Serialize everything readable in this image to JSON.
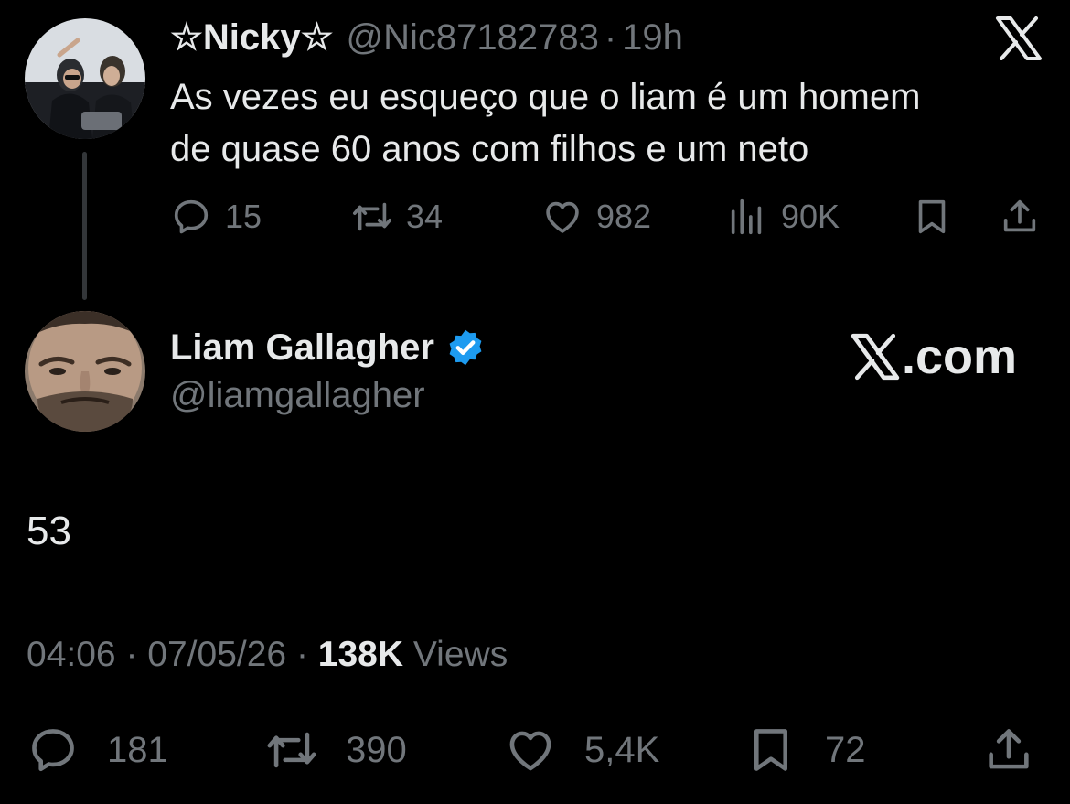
{
  "parent_tweet": {
    "display_name": "☆Nicky☆",
    "handle": "@Nic87182783",
    "separator": "·",
    "time": "19h",
    "text_line_1": "As vezes eu esqueço que o liam é um homem",
    "text_line_2": "de quase 60 anos com filhos e um neto",
    "actions": {
      "replies": "15",
      "reposts": "34",
      "likes": "982",
      "views": "90K"
    }
  },
  "main_tweet": {
    "display_name": "Liam Gallagher",
    "handle": "@liamgallagher",
    "brand_text": ".com",
    "text": "53",
    "time": "04:06",
    "separator": "·",
    "date": "07/05/26",
    "views_count": "138K",
    "views_label": "Views",
    "actions": {
      "replies": "181",
      "reposts": "390",
      "likes": "5,4K",
      "bookmarks": "72"
    }
  },
  "icons": {
    "reply": "speech-bubble-icon",
    "repost": "repost-arrows-icon",
    "like": "heart-icon",
    "views": "bar-chart-icon",
    "bookmark": "bookmark-icon",
    "share": "share-upload-icon",
    "brand": "x-logo-icon",
    "verified": "verified-badge-icon"
  },
  "colors": {
    "background": "#000000",
    "primary_text": "#e7e9ea",
    "secondary_text": "#71767b",
    "verified_blue": "#1d9bf0",
    "thread_line": "#333639"
  }
}
